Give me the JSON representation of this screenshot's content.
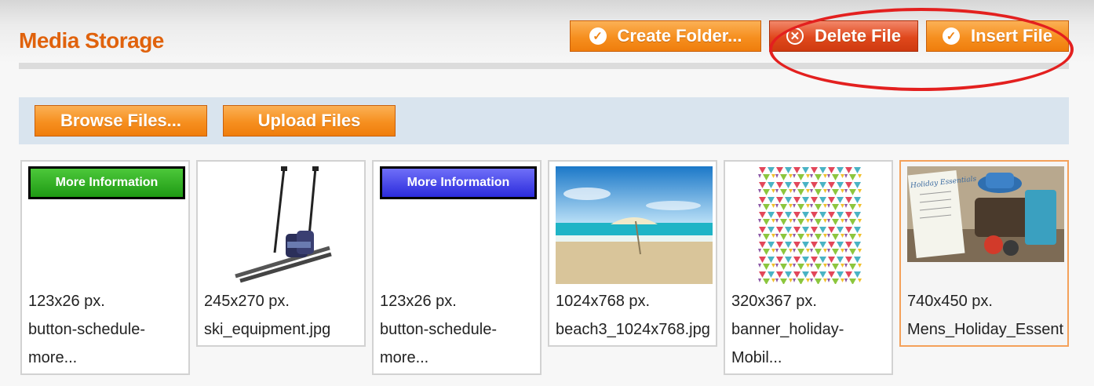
{
  "header": {
    "title": "Media Storage",
    "buttons": {
      "create_folder": "Create Folder...",
      "delete_file": "Delete File",
      "insert_file": "Insert File"
    }
  },
  "toolbar": {
    "browse_files": "Browse Files...",
    "upload_files": "Upload Files"
  },
  "files": [
    {
      "dims": "123x26 px.",
      "name_line1": "button-schedule-",
      "name_line2": "more...",
      "thumb": "green-button",
      "thumb_label": "More Information"
    },
    {
      "dims": "245x270 px.",
      "name_line1": "ski_equipment.jpg",
      "name_line2": "",
      "thumb": "ski-image"
    },
    {
      "dims": "123x26 px.",
      "name_line1": "button-schedule-",
      "name_line2": "more...",
      "thumb": "blue-button",
      "thumb_label": "More Information"
    },
    {
      "dims": "1024x768 px.",
      "name_line1": "beach3_1024x768.jpg",
      "name_line2": "",
      "thumb": "beach-image"
    },
    {
      "dims": "320x367 px.",
      "name_line1": "banner_holiday-",
      "name_line2": "Mobil...",
      "thumb": "triangle-pattern"
    },
    {
      "dims": "740x450 px.",
      "name_line1": "Mens_Holiday_Essentials",
      "name_line2": "",
      "thumb": "holiday-image",
      "thumb_text": "Holiday Essentials"
    }
  ],
  "colors": {
    "title": "#e0620c",
    "button_orange": "#f68f1f",
    "delete_red": "#e0481c",
    "toolbar_bg": "#d9e4ee",
    "annotation": "#e3201f",
    "selected_border": "#f4a15a"
  }
}
